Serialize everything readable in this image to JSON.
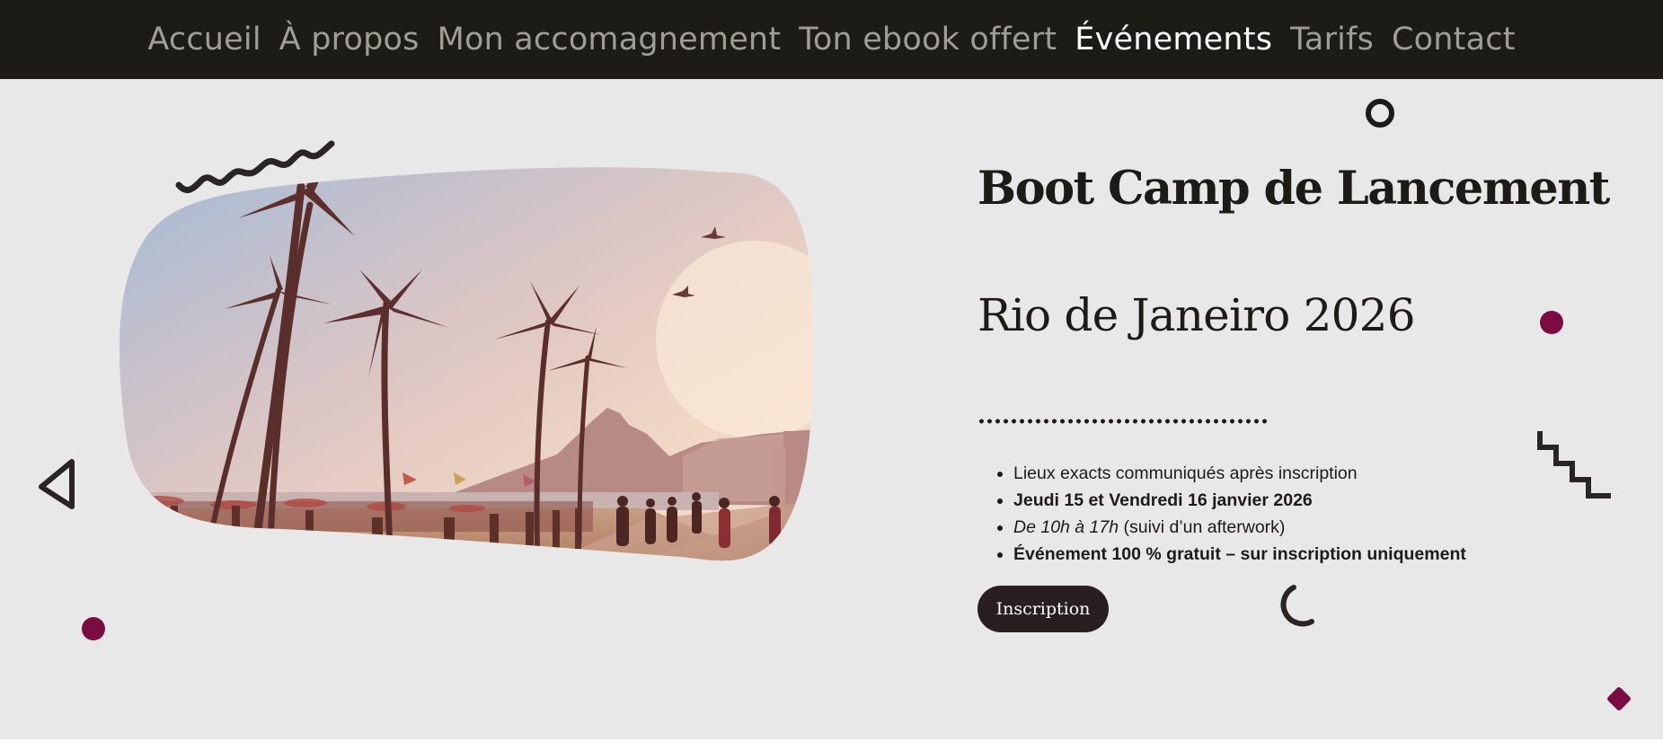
{
  "nav": {
    "items": [
      {
        "label": "Accueil",
        "active": false
      },
      {
        "label": "À propos",
        "active": false
      },
      {
        "label": "Mon accomagnement",
        "active": false
      },
      {
        "label": "Ton ebook offert",
        "active": false
      },
      {
        "label": "Événements",
        "active": true
      },
      {
        "label": "Tarifs",
        "active": false
      },
      {
        "label": "Contact",
        "active": false
      }
    ]
  },
  "event": {
    "title": "Boot Camp de Lancement",
    "subtitle": "Rio de Janeiro 2026",
    "details": {
      "location": "Lieux exacts communiqués après inscription",
      "dates": "Jeudi 15 et Vendredi 16 janvier 2026",
      "hours": "De 10h à 17h",
      "hours_suffix": " (suivi d’un afterwork)",
      "free": "Événement 100 % gratuit – sur inscription uniquement"
    },
    "button_label": "Inscription"
  },
  "colors": {
    "nav_bg": "#1d1b16",
    "nav_text": "#a09c96",
    "nav_active": "#ffffff",
    "hero_bg": "#e8e8e8",
    "accent": "#7a0c42",
    "button_bg": "#2a1f20"
  },
  "icons": {
    "photo": "beach-palm-trees-photo",
    "decorations": [
      "squiggle-icon",
      "ring-icon",
      "dot-icon",
      "triangle-icon",
      "staircase-icon",
      "arc-icon",
      "diamond-icon"
    ]
  }
}
